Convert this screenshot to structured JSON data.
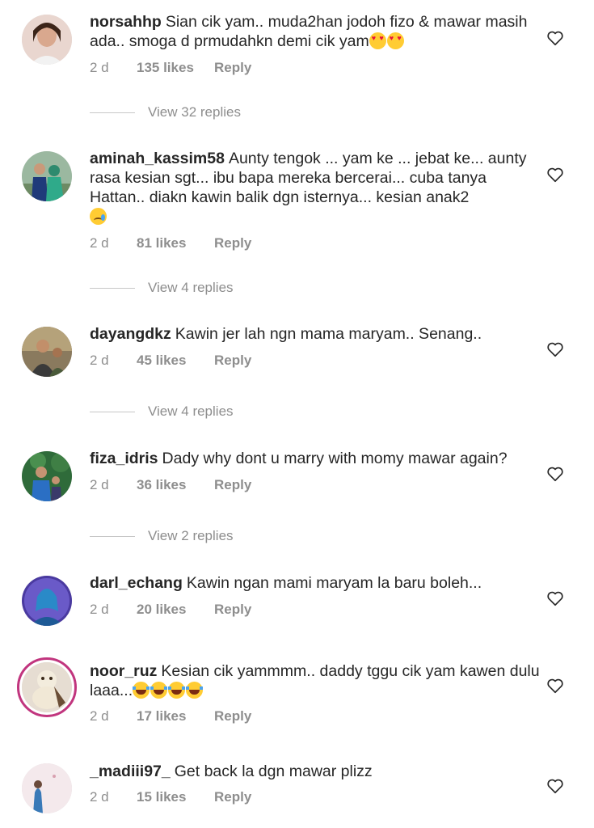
{
  "comments": [
    {
      "username": "norsahhp",
      "text": "Sian cik yam.. muda2han jodoh fizo & mawar masih ada.. smoga d prmudahkn demi cik yam",
      "emoji": [
        "heart-eyes",
        "heart-eyes"
      ],
      "time": "2 d",
      "likes": "135 likes",
      "reply": "Reply",
      "view_replies": "View 32 replies"
    },
    {
      "username": "aminah_kassim58",
      "text": "Aunty tengok ... yam ke ... jebat ke... aunty rasa kesian sgt... ibu bapa mereka bercerai... cuba tanya Hattan.. diakn kawin balik dgn isternya... kesian anak2",
      "emoji": [
        "crying"
      ],
      "time": "2 d",
      "likes": "81 likes",
      "reply": "Reply",
      "view_replies": "View 4 replies"
    },
    {
      "username": "dayangdkz",
      "text": "Kawin jer lah ngn mama maryam.. Senang..",
      "time": "2 d",
      "likes": "45 likes",
      "reply": "Reply",
      "view_replies": "View 4 replies"
    },
    {
      "username": "fiza_idris",
      "text": "Dady why dont u marry with momy mawar again?",
      "time": "2 d",
      "likes": "36 likes",
      "reply": "Reply",
      "view_replies": "View 2 replies"
    },
    {
      "username": "darl_echang",
      "text": "Kawin ngan mami maryam la baru boleh...",
      "time": "2 d",
      "likes": "20 likes",
      "reply": "Reply"
    },
    {
      "username": "noor_ruz",
      "text": "Kesian cik yammmm.. daddy tggu cik yam kawen dulu laaa...",
      "emoji": [
        "rofl",
        "rofl",
        "rofl",
        "rofl"
      ],
      "time": "2 d",
      "likes": "17 likes",
      "reply": "Reply"
    },
    {
      "username": "_madiii97_",
      "text": "Get back la dgn mawar plizz",
      "time": "2 d",
      "likes": "15 likes",
      "reply": "Reply"
    }
  ],
  "colors": {
    "text": "#262626",
    "muted": "#8e8e8e",
    "story_ring": "#c1357e"
  }
}
